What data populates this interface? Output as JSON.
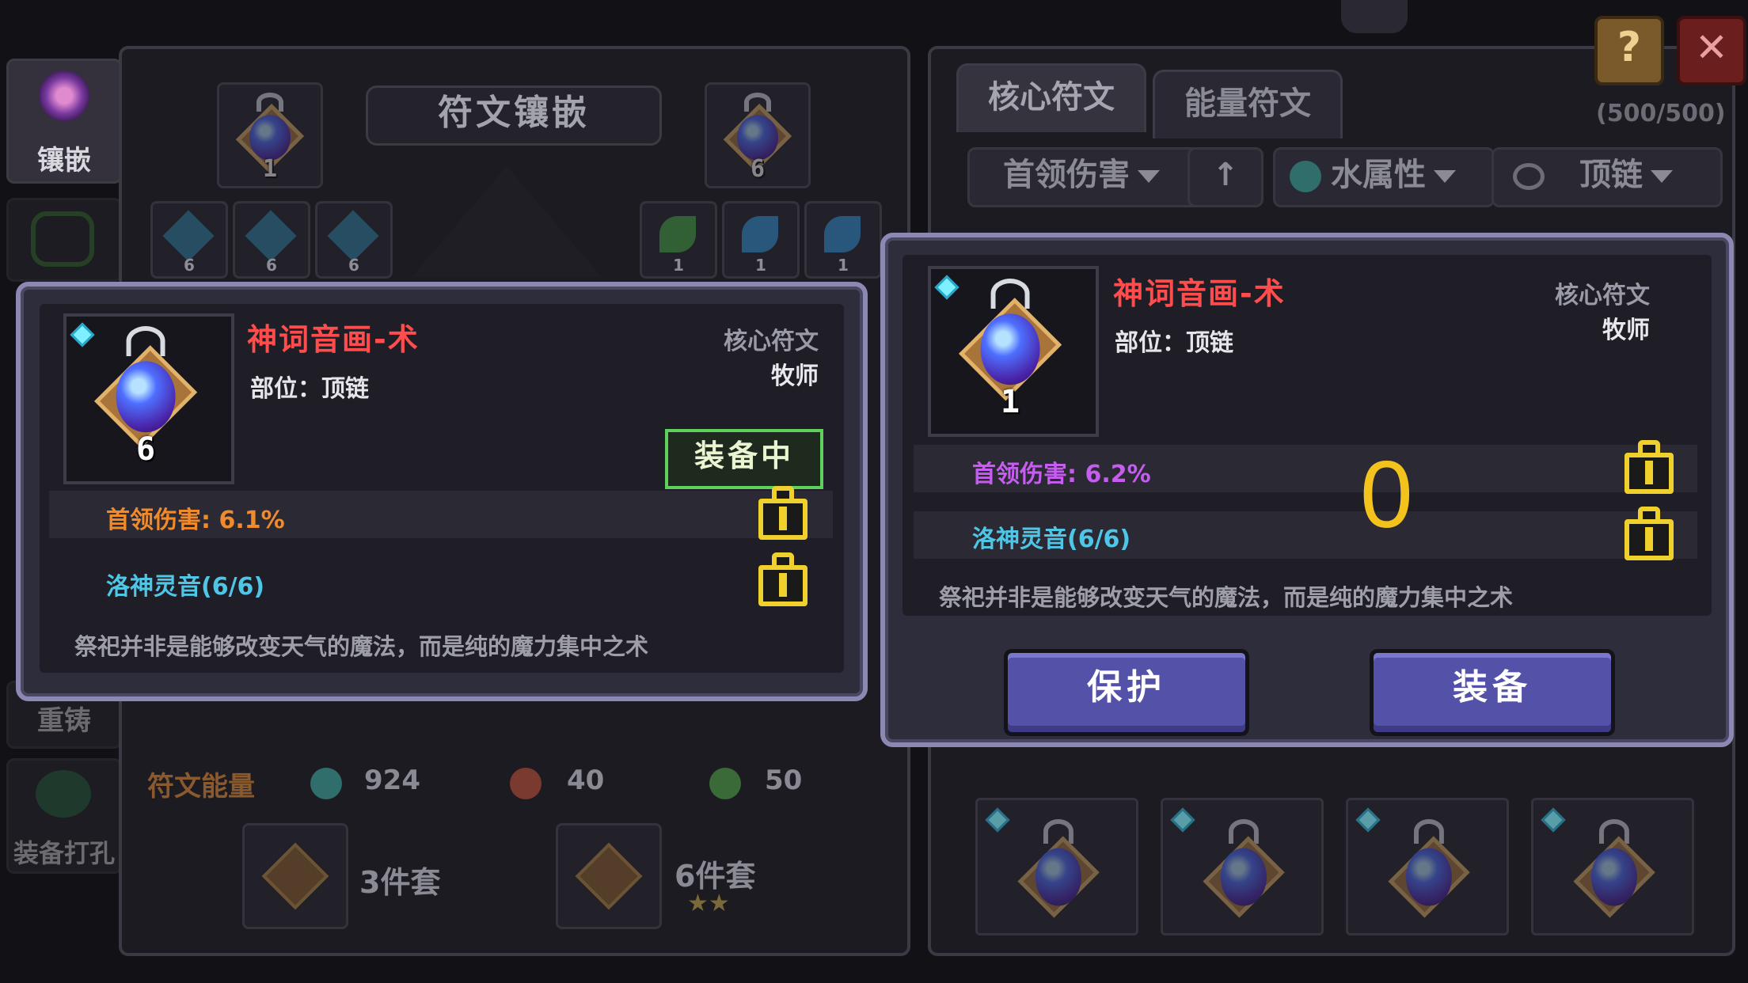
{
  "side_tabs": [
    {
      "label": "镶嵌"
    },
    {
      "label": ""
    },
    {
      "label": "重铸"
    },
    {
      "label": "装备打孔"
    }
  ],
  "inlay_panel": {
    "title": "符文镶嵌",
    "core_slot_left_num": "1",
    "core_slot_right_num": "6",
    "small_slots_left": [
      "6",
      "6",
      "6"
    ],
    "small_slots_right": [
      "1",
      "1",
      "1"
    ]
  },
  "energy": {
    "label": "符文能量",
    "values": [
      "924",
      "40",
      "50"
    ],
    "colors": [
      "#4aa6a0",
      "#c24a3a",
      "#4a9a4a"
    ]
  },
  "sets": [
    {
      "label": "3件套",
      "stars": ""
    },
    {
      "label": "6件套",
      "stars": "★★"
    }
  ],
  "inventory": {
    "tabs": [
      "核心符文",
      "能量符文"
    ],
    "count": "(500/500)",
    "filters": {
      "stat": "首领伤害",
      "sort_icon": "↑",
      "element": "水属性",
      "slot": "顶链"
    }
  },
  "card_equipped": {
    "name": "神词音画-术",
    "slot": "部位：顶链",
    "type": "核心符文",
    "class": "牧师",
    "level": "6",
    "badge": "装备中",
    "stat1": "首领伤害: 6.1%",
    "stat2": "洛神灵音(6/6)",
    "desc": "祭祀并非是能够改变天气的魔法，而是纯的魔力集中之术",
    "stat1_color": "#f08a2a",
    "stat2_color": "#4fc6e6"
  },
  "card_compare": {
    "name": "神词音画-术",
    "slot": "部位：顶链",
    "type": "核心符文",
    "class": "牧师",
    "level": "1",
    "stat1": "首领伤害: 6.2%",
    "stat2": "洛神灵音(6/6)",
    "desc": "祭祀并非是能够改变天气的魔法，而是纯的魔力集中之术",
    "overlay_number": "0",
    "stat1_color": "#c65cf0",
    "stat2_color": "#4fc6e6",
    "protect_label": "保护",
    "equip_label": "装备"
  },
  "top_buttons": {
    "help": "?",
    "close": "✕"
  }
}
